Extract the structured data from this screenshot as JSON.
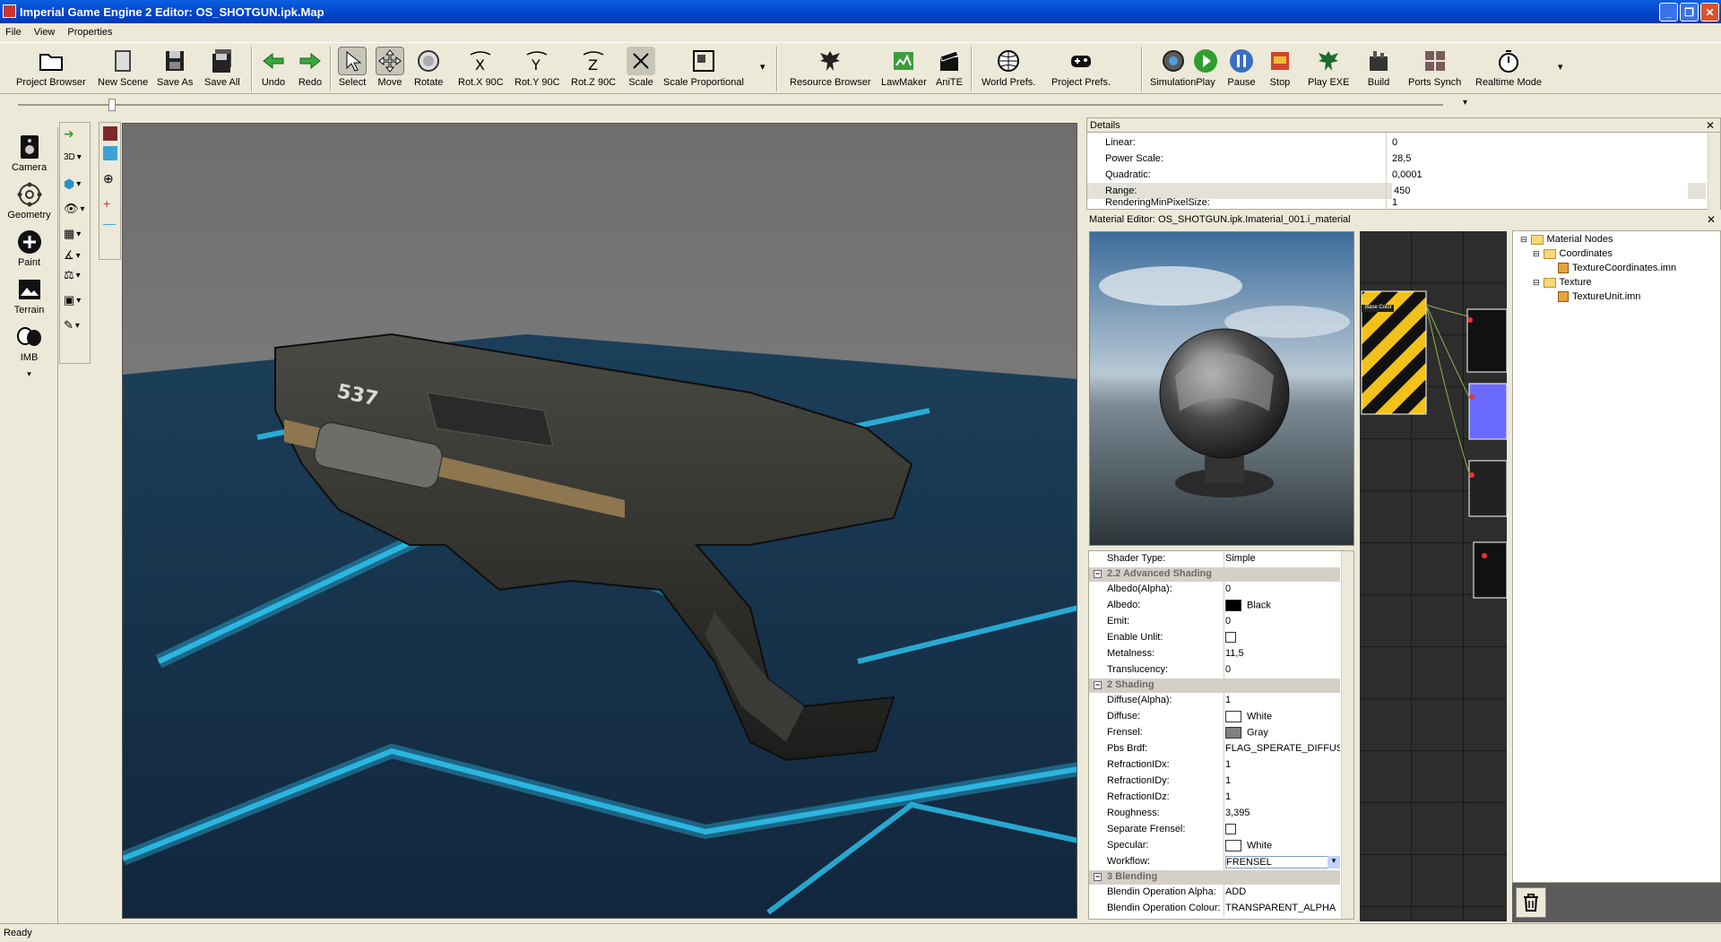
{
  "window": {
    "title": "Imperial Game Engine 2 Editor: OS_SHOTGUN.ipk.Map"
  },
  "menu": [
    "File",
    "View",
    "Properties"
  ],
  "toolbar": [
    {
      "label": "Project Browser",
      "icon": "folder-icon"
    },
    {
      "label": "New Scene",
      "icon": "new-scene-icon"
    },
    {
      "label": "Save As",
      "icon": "save-as-icon"
    },
    {
      "label": "Save All",
      "icon": "save-all-icon"
    },
    {
      "label": "Undo",
      "icon": "undo-icon"
    },
    {
      "label": "Redo",
      "icon": "redo-icon"
    },
    {
      "label": "Select",
      "icon": "cursor-icon"
    },
    {
      "label": "Move",
      "icon": "move-icon"
    },
    {
      "label": "Rotate",
      "icon": "rotate-icon"
    },
    {
      "label": "Rot.X 90C",
      "icon": "rot-x-icon"
    },
    {
      "label": "Rot.Y 90C",
      "icon": "rot-y-icon"
    },
    {
      "label": "Rot.Z 90C",
      "icon": "rot-z-icon"
    },
    {
      "label": "Scale",
      "icon": "scale-icon"
    },
    {
      "label": "Scale Proportional",
      "icon": "scale-proportional-icon"
    },
    {
      "label": "Resource Browser",
      "icon": "eagle-icon"
    },
    {
      "label": "LawMaker",
      "icon": "lawmaker-icon"
    },
    {
      "label": "AniTE",
      "icon": "clapper-icon"
    },
    {
      "label": "World Prefs.",
      "icon": "globe-icon"
    },
    {
      "label": "Project Prefs.",
      "icon": "gamepad-icon"
    },
    {
      "label": "Simulation",
      "icon": "gear-icon"
    },
    {
      "label": "Play",
      "icon": "play-icon"
    },
    {
      "label": "Pause",
      "icon": "pause-icon"
    },
    {
      "label": "Stop",
      "icon": "stop-icon"
    },
    {
      "label": "Play EXE",
      "icon": "eagle-exe-icon"
    },
    {
      "label": "Build",
      "icon": "build-icon"
    },
    {
      "label": "Ports Synch",
      "icon": "ports-icon"
    },
    {
      "label": "Realtime Mode",
      "icon": "stopwatch-icon"
    }
  ],
  "left_panel": [
    {
      "label": "Camera",
      "icon": "camera-icon"
    },
    {
      "label": "Geometry",
      "icon": "geometry-icon"
    },
    {
      "label": "Paint",
      "icon": "paint-icon"
    },
    {
      "label": "Terrain",
      "icon": "terrain-icon"
    },
    {
      "label": "IMB",
      "icon": "masks-icon"
    }
  ],
  "viewport_tools": {
    "mode": "3D"
  },
  "details": {
    "title": "Details",
    "rows": [
      {
        "label": "Linear:",
        "value": "0"
      },
      {
        "label": "Power Scale:",
        "value": "28,5"
      },
      {
        "label": "Quadratic:",
        "value": "0,0001"
      },
      {
        "label": "Range:",
        "value": "450"
      },
      {
        "label": "RenderingMinPixelSize:",
        "value": "1"
      }
    ]
  },
  "material_editor": {
    "title": "Material Editor: OS_SHOTGUN.ipk.Imaterial_001.i_material",
    "shader_type": {
      "label": "Shader Type:",
      "value": "Simple"
    },
    "groups": [
      {
        "title": "2.2 Advanced Shading",
        "rows": [
          {
            "label": "Albedo(Alpha):",
            "value": "0"
          },
          {
            "label": "Albedo:",
            "value": "Black",
            "swatch": "#000000"
          },
          {
            "label": "Emit:",
            "value": "0"
          },
          {
            "label": "Enable Unlit:",
            "value": "",
            "checkbox": true
          },
          {
            "label": "Metalness:",
            "value": "11,5"
          },
          {
            "label": "Translucency:",
            "value": "0"
          }
        ]
      },
      {
        "title": "2 Shading",
        "rows": [
          {
            "label": "Diffuse(Alpha):",
            "value": "1"
          },
          {
            "label": "Diffuse:",
            "value": "White",
            "swatch": "#ffffff"
          },
          {
            "label": "Frensel:",
            "value": "Gray",
            "swatch": "#808080"
          },
          {
            "label": "Pbs Brdf:",
            "value": "FLAG_SPERATE_DIFFUSE_"
          },
          {
            "label": "RefractionIDx:",
            "value": "1"
          },
          {
            "label": "RefractionIDy:",
            "value": "1"
          },
          {
            "label": "RefractionIDz:",
            "value": "1"
          },
          {
            "label": "Roughness:",
            "value": "3,395"
          },
          {
            "label": "Separate Frensel:",
            "value": "",
            "checkbox": true
          },
          {
            "label": "Specular:",
            "value": "White",
            "swatch": "#ffffff"
          },
          {
            "label": "Workflow:",
            "value": "FRENSEL",
            "dropdown": true
          }
        ]
      },
      {
        "title": "3 Blending",
        "rows": [
          {
            "label": "Blendin Operation Alpha:",
            "value": "ADD"
          },
          {
            "label": "Blendin Operation Colour:",
            "value": "TRANSPARENT_ALPHA"
          }
        ]
      }
    ],
    "node_graph": {
      "node_label": "Base Color"
    },
    "tree": {
      "root": "Material Nodes",
      "children": [
        {
          "label": "Coordinates",
          "items": [
            "TextureCoordinates.imn"
          ]
        },
        {
          "label": "Texture",
          "items": [
            "TextureUnit.imn"
          ]
        }
      ]
    }
  },
  "status": "Ready",
  "colors": {
    "title_bar": "#0a5fe0",
    "chrome": "#ece9d8",
    "grid_glow": "#2fd2ff"
  }
}
